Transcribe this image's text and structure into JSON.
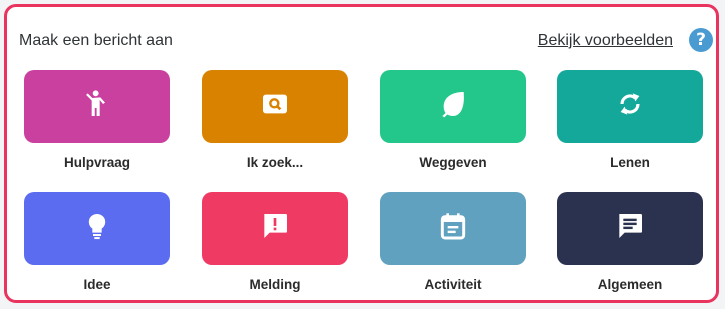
{
  "header": {
    "title": "Maak een bericht aan",
    "examples_link": "Bekijk voorbeelden",
    "help_glyph": "?"
  },
  "colors": {
    "border": "#e8345f",
    "help": "#4a9bd2"
  },
  "tiles": [
    {
      "label": "Hulpvraag",
      "color": "#c9409f",
      "icon": "person-waving-icon"
    },
    {
      "label": "Ik zoek...",
      "color": "#d98200",
      "icon": "search-box-icon"
    },
    {
      "label": "Weggeven",
      "color": "#23c78b",
      "icon": "leaf-icon"
    },
    {
      "label": "Lenen",
      "color": "#14a89a",
      "icon": "sync-arrows-icon"
    },
    {
      "label": "Idee",
      "color": "#5b6cf0",
      "icon": "lightbulb-icon"
    },
    {
      "label": "Melding",
      "color": "#ef3a63",
      "icon": "alert-message-icon"
    },
    {
      "label": "Activiteit",
      "color": "#5fa1bf",
      "icon": "calendar-icon"
    },
    {
      "label": "Algemeen",
      "color": "#2b3250",
      "icon": "chat-message-icon"
    }
  ]
}
